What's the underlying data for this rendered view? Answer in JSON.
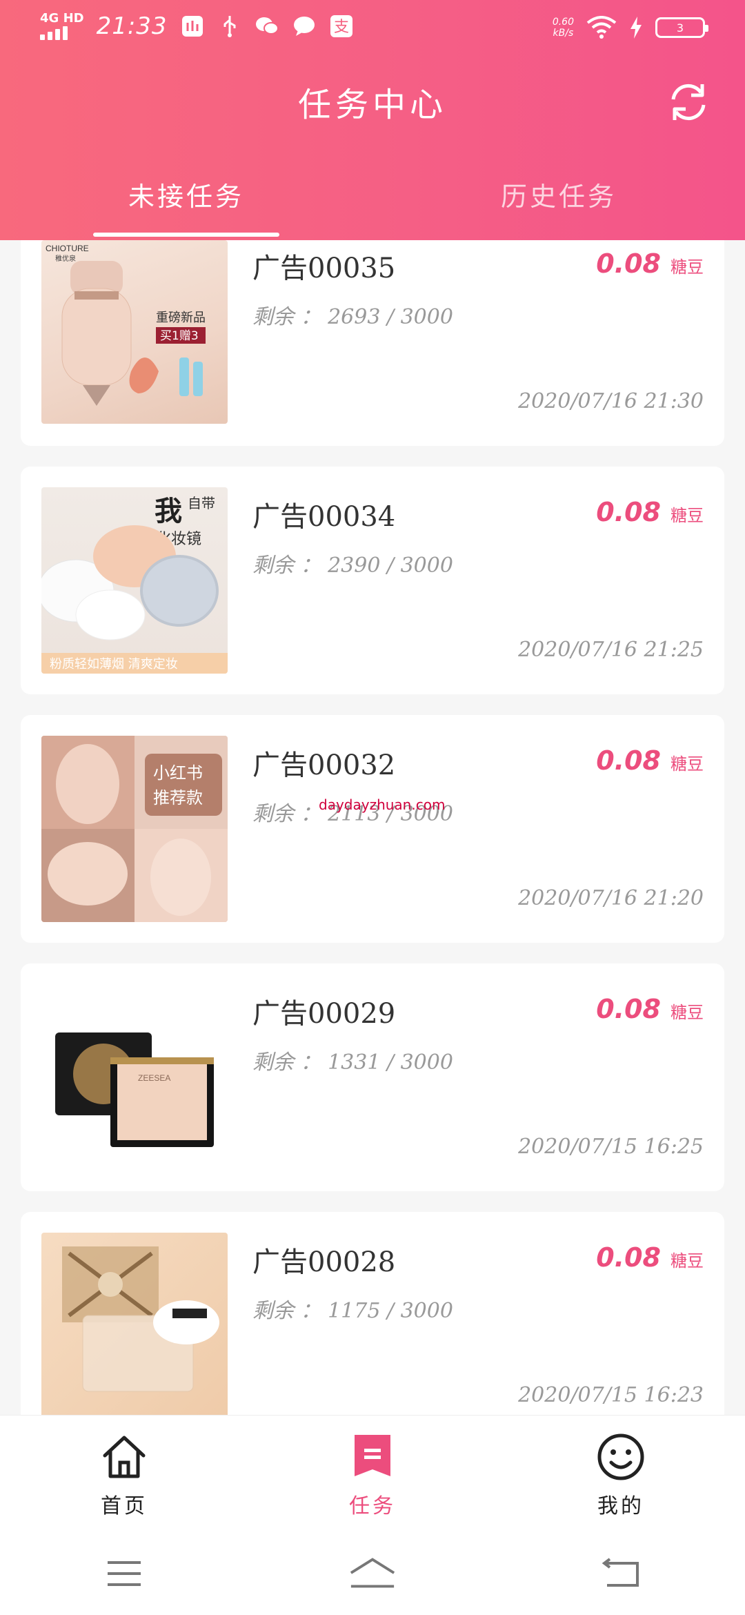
{
  "status_bar": {
    "network": "4G HD",
    "time": "21:33",
    "speed_value": "0.60",
    "speed_unit": "kB/s",
    "battery": "3"
  },
  "header": {
    "title": "任务中心"
  },
  "tabs": [
    {
      "label": "未接任务",
      "active": true
    },
    {
      "label": "历史任务",
      "active": false
    }
  ],
  "tasks": [
    {
      "name": "广告00035",
      "remaining": "剩余 ： 2693 / 3000",
      "price": "0.08",
      "unit": "糖豆",
      "date": "2020/07/16 21:30",
      "thumb_brand": "CHIOTURE",
      "thumb_brand_cn": "稚优泉",
      "thumb_text1": "重磅新品",
      "thumb_text2": "买1赠3"
    },
    {
      "name": "广告00034",
      "remaining": "剩余 ： 2390 / 3000",
      "price": "0.08",
      "unit": "糖豆",
      "date": "2020/07/16 21:25",
      "thumb_text1": "我",
      "thumb_text2": "自带",
      "thumb_text3": "化妆镜",
      "thumb_text4": "粉质轻如薄烟 清爽定妆"
    },
    {
      "name": "广告00032",
      "remaining": "剩余 ： 2113 / 3000",
      "price": "0.08",
      "unit": "糖豆",
      "date": "2020/07/16 21:20",
      "thumb_text1": "小红书",
      "thumb_text2": "推荐款",
      "watermark": "daydayzhuan.com"
    },
    {
      "name": "广告00029",
      "remaining": "剩余 ： 1331 / 3000",
      "price": "0.08",
      "unit": "糖豆",
      "date": "2020/07/15 16:25",
      "thumb_brand": "ZEESEA"
    },
    {
      "name": "广告00028",
      "remaining": "剩余 ： 1175 / 3000",
      "price": "0.08",
      "unit": "糖豆",
      "date": "2020/07/15 16:23"
    }
  ],
  "bottom_nav": [
    {
      "label": "首页",
      "icon": "home-icon",
      "active": false
    },
    {
      "label": "任务",
      "icon": "task-icon",
      "active": true
    },
    {
      "label": "我的",
      "icon": "smiley-icon",
      "active": false
    }
  ],
  "colors": {
    "accent": "#ec4d7d",
    "header_start": "#f8697d",
    "header_end": "#f4548a"
  }
}
